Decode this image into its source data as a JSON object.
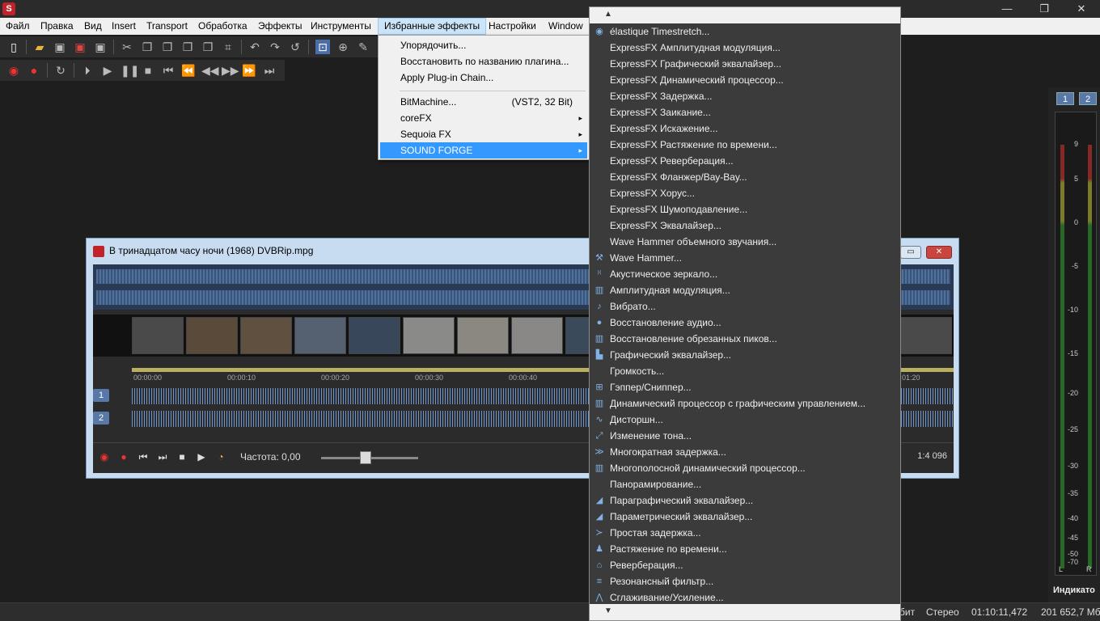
{
  "window": {
    "min_glyph": "—",
    "max_glyph": "❐",
    "close_glyph": "✕"
  },
  "menubar": {
    "items": [
      "Файл",
      "Правка",
      "Вид",
      "Insert",
      "Transport",
      "Обработка",
      "Эффекты",
      "Инструменты",
      "Избранные эффекты",
      "Настройки",
      "Window"
    ],
    "active": "Избранные эффекты"
  },
  "favorites_menu": {
    "items": [
      {
        "label": "Упорядочить...",
        "right": ""
      },
      {
        "label": "Восстановить по названию плагина...",
        "right": ""
      },
      {
        "label": "Apply Plug-in Chain...",
        "right": ""
      },
      {
        "label": "BitMachine...",
        "right": "(VST2, 32 Bit)"
      },
      {
        "label": "coreFX",
        "right": "▸"
      },
      {
        "label": "Sequoia FX",
        "right": "▸"
      },
      {
        "label": "SOUND FORGE",
        "right": "▸"
      }
    ]
  },
  "soundforge_menu": {
    "scroll_up": "▲",
    "scroll_down": "▼",
    "items": [
      {
        "label": "élastique Timestretch...",
        "icon": "waveform-icon",
        "glyph": "◉"
      },
      {
        "label": "ExpressFX Амплитудная модуляция...",
        "icon": "",
        "glyph": ""
      },
      {
        "label": "ExpressFX Графический эквалайзер...",
        "icon": "",
        "glyph": ""
      },
      {
        "label": "ExpressFX Динамический процессор...",
        "icon": "",
        "glyph": ""
      },
      {
        "label": "ExpressFX Задержка...",
        "icon": "",
        "glyph": ""
      },
      {
        "label": "ExpressFX Заикание...",
        "icon": "",
        "glyph": ""
      },
      {
        "label": "ExpressFX Искажение...",
        "icon": "",
        "glyph": ""
      },
      {
        "label": "ExpressFX Растяжение по времени...",
        "icon": "",
        "glyph": ""
      },
      {
        "label": "ExpressFX Реверберация...",
        "icon": "",
        "glyph": ""
      },
      {
        "label": "ExpressFX Фланжер/Вау-Вау...",
        "icon": "",
        "glyph": ""
      },
      {
        "label": "ExpressFX Хорус...",
        "icon": "",
        "glyph": ""
      },
      {
        "label": "ExpressFX Шумоподавление...",
        "icon": "",
        "glyph": ""
      },
      {
        "label": "ExpressFX Эквалайзер...",
        "icon": "",
        "glyph": ""
      },
      {
        "label": "Wave Hammer объемного звучания...",
        "icon": "",
        "glyph": ""
      },
      {
        "label": "Wave Hammer...",
        "icon": "hammer-icon",
        "glyph": "⚒"
      },
      {
        "label": "Акустическое зеркало...",
        "icon": "mirror-icon",
        "glyph": "⁾⁽"
      },
      {
        "label": "Амплитудная модуляция...",
        "icon": "amp-mod-icon",
        "glyph": "▥"
      },
      {
        "label": "Вибрато...",
        "icon": "vibrato-icon",
        "glyph": "♪"
      },
      {
        "label": "Восстановление аудио...",
        "icon": "restore-icon",
        "glyph": "●"
      },
      {
        "label": "Восстановление обрезанных пиков...",
        "icon": "clip-restore-icon",
        "glyph": "▥"
      },
      {
        "label": "Графический эквалайзер...",
        "icon": "graphic-eq-icon",
        "glyph": "▙"
      },
      {
        "label": "Громкость...",
        "icon": "",
        "glyph": ""
      },
      {
        "label": "Гэппер/Сниппер...",
        "icon": "gapper-icon",
        "glyph": "⊞"
      },
      {
        "label": "Динамический процессор с графическим управлением...",
        "icon": "dynamics-icon",
        "glyph": "▥"
      },
      {
        "label": "Дисторшн...",
        "icon": "distortion-icon",
        "glyph": "∿"
      },
      {
        "label": "Изменение тона...",
        "icon": "pitch-icon",
        "glyph": "⤢"
      },
      {
        "label": "Многократная задержка...",
        "icon": "multi-delay-icon",
        "glyph": "≫"
      },
      {
        "label": "Многополосной динамический процессор...",
        "icon": "multiband-icon",
        "glyph": "▥"
      },
      {
        "label": "Панорамирование...",
        "icon": "",
        "glyph": ""
      },
      {
        "label": "Параграфический эквалайзер...",
        "icon": "paragraphic-eq-icon",
        "glyph": "◢"
      },
      {
        "label": "Параметрический эквалайзер...",
        "icon": "parametric-eq-icon",
        "glyph": "◢"
      },
      {
        "label": "Простая задержка...",
        "icon": "simple-delay-icon",
        "glyph": "≻"
      },
      {
        "label": "Растяжение по времени...",
        "icon": "time-stretch-icon",
        "glyph": "♟"
      },
      {
        "label": "Реверберация...",
        "icon": "reverb-icon",
        "glyph": "⌂"
      },
      {
        "label": "Резонансный фильтр...",
        "icon": "resonant-filter-icon",
        "glyph": "≡"
      },
      {
        "label": "Сглаживание/Усиление...",
        "icon": "smooth-icon",
        "glyph": "⋀"
      }
    ]
  },
  "document": {
    "title": "В тринадцатом часу ночи (1968) DVBRip.mpg",
    "ruler_ticks": [
      "00:00:00",
      "00:00:10",
      "00:00:20",
      "00:00:30",
      "00:00:40",
      "01:20"
    ],
    "tracks": [
      "1",
      "2"
    ],
    "frequency": "Частота: 0,00",
    "zoom": "1:4 096"
  },
  "meter": {
    "tabs": [
      "1",
      "2"
    ],
    "labels": [
      "9",
      "5",
      "0",
      "-5",
      "-10",
      "-15",
      "-20",
      "-25",
      "-30",
      "-35",
      "-40",
      "-45",
      "-50",
      "-70"
    ],
    "left": "L",
    "right": "R",
    "title": "Индикато"
  },
  "status": {
    "bit": "бит",
    "channels": "Стерео",
    "time": "01:10:11,472",
    "size": "201 652,7 Мб"
  }
}
